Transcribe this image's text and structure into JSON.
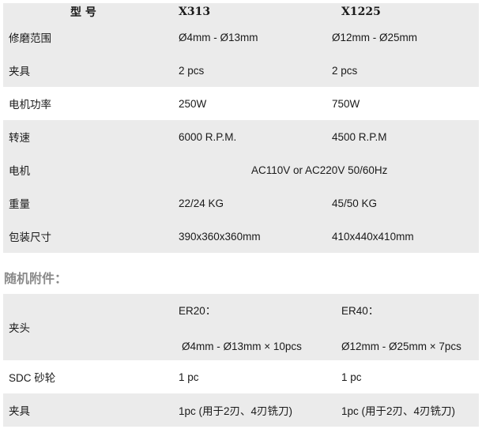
{
  "spec_table": {
    "header": {
      "label": "型 号",
      "col1": "X313",
      "col2": "X1225"
    },
    "rows": [
      {
        "label": "修磨范围",
        "v1": "Ø4mm - Ø13mm",
        "v2": "Ø12mm - Ø25mm"
      },
      {
        "label": "夹具",
        "v1": "2 pcs",
        "v2": "2 pcs"
      },
      {
        "label": "电机功率",
        "v1": "250W",
        "v2": "750W"
      },
      {
        "label": "转速",
        "v1": "6000 R.P.M.",
        "v2": "4500 R.P.M"
      },
      {
        "label": "电机",
        "merged": "AC110V or AC220V 50/60Hz"
      },
      {
        "label": "重量",
        "v1": "22/24 KG",
        "v2": "45/50 KG"
      },
      {
        "label": "包装尺寸",
        "v1": "390x360x360mm",
        "v2": "410x440x410mm"
      }
    ]
  },
  "accessories": {
    "title": "随机附件：",
    "rows": [
      {
        "label": "夹头",
        "v1_top": "ER20：",
        "v1_bottom": "Ø4mm - Ø13mm × 10pcs",
        "v2_top": "ER40：",
        "v2_bottom": "Ø12mm - Ø25mm × 7pcs"
      },
      {
        "label": "SDC 砂轮",
        "v1": "1 pc",
        "v2": "1 pc"
      },
      {
        "label": "夹具",
        "v1": "1pc (用于2刃、4刃铣刀)",
        "v2": "1pc (用于2刃、4刃铣刀)"
      }
    ]
  }
}
